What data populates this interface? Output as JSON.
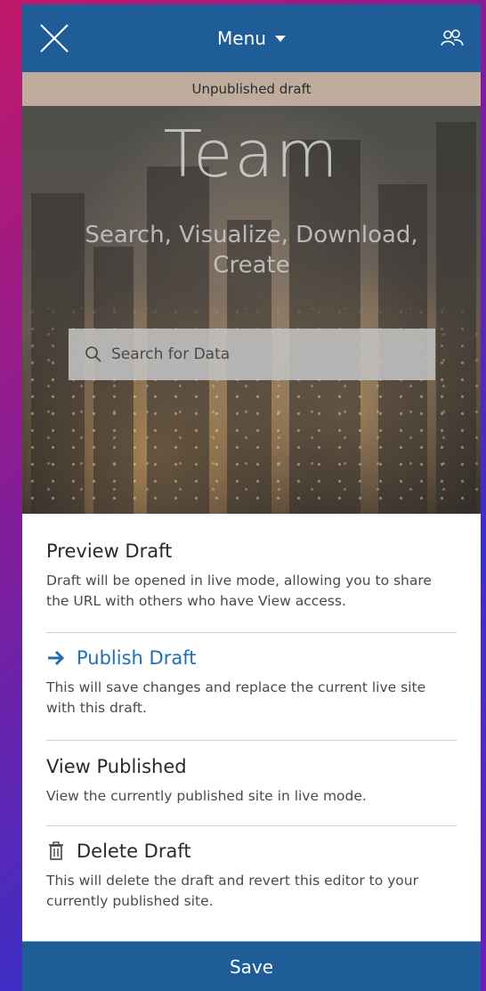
{
  "topbar": {
    "menu_label": "Menu",
    "icons": {
      "close": "close-icon",
      "menu_caret": "caret-down-icon",
      "users": "users-icon"
    },
    "color": "#1f5d98"
  },
  "banner": {
    "text": "Unpublished draft",
    "color": "#bfac9c"
  },
  "hero": {
    "title": "Team",
    "subtitle": "Search, Visualize, Download, Create",
    "search": {
      "placeholder": "Search for Data",
      "value": "",
      "icon": "search-icon"
    }
  },
  "menu": {
    "preview": {
      "title": "Preview Draft",
      "description": "Draft will be opened in live mode, allowing you to share the URL with others who have View access."
    },
    "publish": {
      "title": "Publish Draft",
      "description": "This will save changes and replace the current live site with this draft.",
      "icon": "arrow-right-icon",
      "color": "#1f6fb5"
    },
    "view_published": {
      "title": "View Published",
      "description": "View the currently published site in live mode."
    },
    "delete": {
      "title": "Delete Draft",
      "description": "This will delete the draft and revert this editor to your currently published site.",
      "icon": "trash-icon"
    }
  },
  "save": {
    "label": "Save"
  }
}
